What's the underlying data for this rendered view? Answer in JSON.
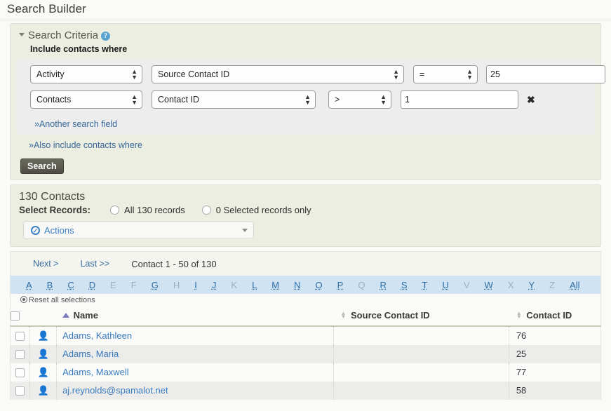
{
  "page": {
    "title": "Search Builder"
  },
  "criteria": {
    "section_title": "Search Criteria",
    "help_icon": "help-icon",
    "include_label": "Include contacts where",
    "rows": [
      {
        "entity": "Activity",
        "field": "Source Contact ID",
        "operator": "=",
        "value": "25",
        "removable": false
      },
      {
        "entity": "Contacts",
        "field": "Contact ID",
        "operator": ">",
        "value": "1",
        "removable": true,
        "remove_label": "✖"
      }
    ],
    "entity_options": [
      "Activity",
      "Contacts"
    ],
    "field_options": [
      "Source Contact ID",
      "Contact ID"
    ],
    "operator_options": [
      "=",
      ">"
    ],
    "another_field_link": "»Another search field",
    "also_include_link": "»Also include contacts where",
    "search_button": "Search"
  },
  "results": {
    "count_label": "130 Contacts",
    "select_records_label": "Select Records:",
    "radio_all": "All 130 records",
    "radio_selected": "0 Selected records only",
    "actions_label": "Actions"
  },
  "pager": {
    "next": "Next >",
    "last": "Last >>",
    "range": "Contact 1 - 50 of 130"
  },
  "alphabet": [
    {
      "label": "A",
      "active": true
    },
    {
      "label": "B",
      "active": true
    },
    {
      "label": "C",
      "active": true
    },
    {
      "label": "D",
      "active": true
    },
    {
      "label": "E",
      "active": false
    },
    {
      "label": "F",
      "active": false
    },
    {
      "label": "G",
      "active": true
    },
    {
      "label": "H",
      "active": false
    },
    {
      "label": "I",
      "active": true
    },
    {
      "label": "J",
      "active": true
    },
    {
      "label": "K",
      "active": false
    },
    {
      "label": "L",
      "active": true
    },
    {
      "label": "M",
      "active": true
    },
    {
      "label": "N",
      "active": true
    },
    {
      "label": "O",
      "active": true
    },
    {
      "label": "P",
      "active": true
    },
    {
      "label": "Q",
      "active": false
    },
    {
      "label": "R",
      "active": true
    },
    {
      "label": "S",
      "active": true
    },
    {
      "label": "T",
      "active": true
    },
    {
      "label": "U",
      "active": true
    },
    {
      "label": "V",
      "active": false
    },
    {
      "label": "W",
      "active": true
    },
    {
      "label": "X",
      "active": false
    },
    {
      "label": "Y",
      "active": true
    },
    {
      "label": "Z",
      "active": false
    },
    {
      "label": "All",
      "active": true
    }
  ],
  "table": {
    "reset_label": "Reset all selections",
    "columns": [
      {
        "key": "checkbox",
        "label": ""
      },
      {
        "key": "icon",
        "label": ""
      },
      {
        "key": "name",
        "label": "Name",
        "sort": "asc"
      },
      {
        "key": "source_contact_id",
        "label": "Source Contact ID",
        "sort": "none"
      },
      {
        "key": "contact_id",
        "label": "Contact ID",
        "sort": "none"
      }
    ],
    "rows": [
      {
        "name": "Adams, Kathleen",
        "source_contact_id": "",
        "contact_id": "76",
        "icon": "contact-individual-icon"
      },
      {
        "name": "Adams, Maria",
        "source_contact_id": "",
        "contact_id": "25",
        "icon": "contact-individual-icon"
      },
      {
        "name": "Adams, Maxwell",
        "source_contact_id": "",
        "contact_id": "77",
        "icon": "contact-individual-icon"
      },
      {
        "name": "aj.reynolds@spamalot.net",
        "source_contact_id": "",
        "contact_id": "58",
        "icon": "contact-individual-icon"
      }
    ]
  },
  "colors": {
    "panel_bg": "#edeee2",
    "link": "#38699c",
    "alpha_bar": "#cfe3f3",
    "accent": "#3d80c2",
    "button_bg": "#59584f"
  }
}
